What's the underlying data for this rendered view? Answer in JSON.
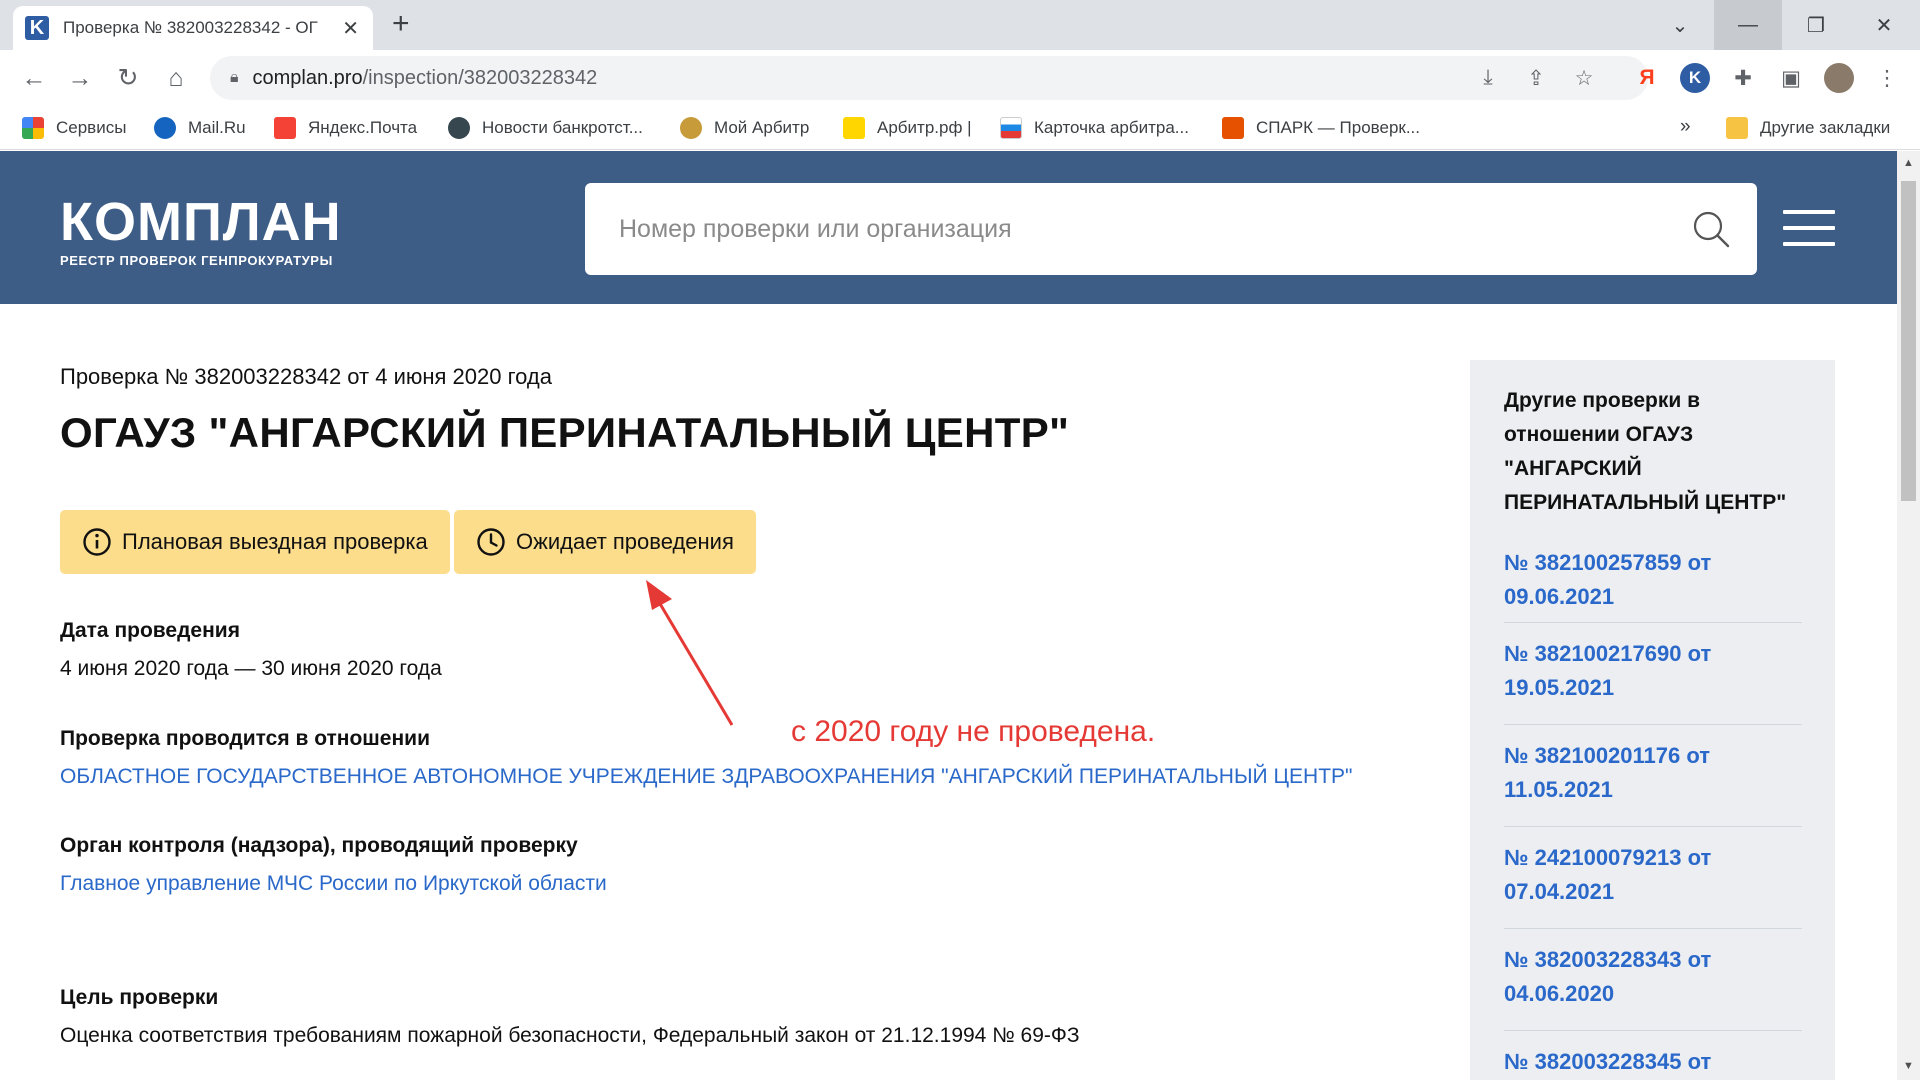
{
  "browser": {
    "tab_title": "Проверка № 382003228342 - ОГ",
    "tab_close": "✕",
    "new_tab": "+",
    "url_domain": "complan.pro",
    "url_path": "/inspection/382003228342",
    "bookmarks": [
      {
        "label": "Сервисы",
        "color": "#ea4335"
      },
      {
        "label": "Mail.Ru",
        "color": "#1565c0"
      },
      {
        "label": "Яндекс.Почта",
        "color": "#f44336"
      },
      {
        "label": "Новости банкротст...",
        "color": "#37474f"
      },
      {
        "label": "Мой Арбитр",
        "color": "#c79a3a"
      },
      {
        "label": "Арбитр.рф |",
        "color": "#ffd600"
      },
      {
        "label": "Карточка арбитра...",
        "color": "#1e88e5"
      },
      {
        "label": "СПАРК — Проверк...",
        "color": "#e65100"
      }
    ],
    "bookmarks_more": "»",
    "other_bookmarks": "Другие закладки"
  },
  "site": {
    "logo_main": "КОМПЛАН",
    "logo_sub": "РЕЕСТР ПРОВЕРОК ГЕНПРОКУРАТУРЫ",
    "search_placeholder": "Номер проверки или организация",
    "header_color": "#3e5d86"
  },
  "inspection": {
    "number_line": "Проверка № 382003228342 от 4 июня 2020 года",
    "org_title": "ОГАУЗ \"АНГАРСКИЙ ПЕРИНАТАЛЬНЫЙ ЦЕНТР\"",
    "badges": [
      {
        "label": "Плановая выездная проверка",
        "icon": "info-icon"
      },
      {
        "label": "Ожидает проведения",
        "icon": "clock-icon"
      }
    ],
    "date_label": "Дата проведения",
    "date_value": "4 июня 2020 года — 30 июня 2020 года",
    "subject_label": "Проверка проводится в отношении",
    "subject_value": "ОБЛАСТНОЕ ГОСУДАРСТВЕННОЕ АВТОНОМНОЕ УЧРЕЖДЕНИЕ ЗДРАВООХРАНЕНИЯ \"АНГАРСКИЙ ПЕРИНАТАЛЬНЫЙ ЦЕНТР\"",
    "authority_label": "Орган контроля (надзора), проводящий проверку",
    "authority_value": "Главное управление МЧС России по Иркутской области",
    "goal_label": "Цель проверки",
    "goal_value": "Оценка соответствия требованиям пожарной безопасности, Федеральный закон от 21.12.1994 № 69-ФЗ"
  },
  "annotation": {
    "text": "с 2020 году не проведена.",
    "color": "#e53935"
  },
  "sidebar": {
    "title": "Другие проверки в отношении ОГАУЗ \"АНГАРСКИЙ ПЕРИНАТАЛЬНЫЙ ЦЕНТР\"",
    "items": [
      {
        "label": "№ 382100257859 от 09.06.2021"
      },
      {
        "label": "№ 382100217690 от 19.05.2021"
      },
      {
        "label": "№ 382100201176 от 11.05.2021"
      },
      {
        "label": "№ 242100079213 от 07.04.2021"
      },
      {
        "label": "№ 382003228343 от 04.06.2020"
      },
      {
        "label": "№ 382003228345 от"
      }
    ]
  }
}
